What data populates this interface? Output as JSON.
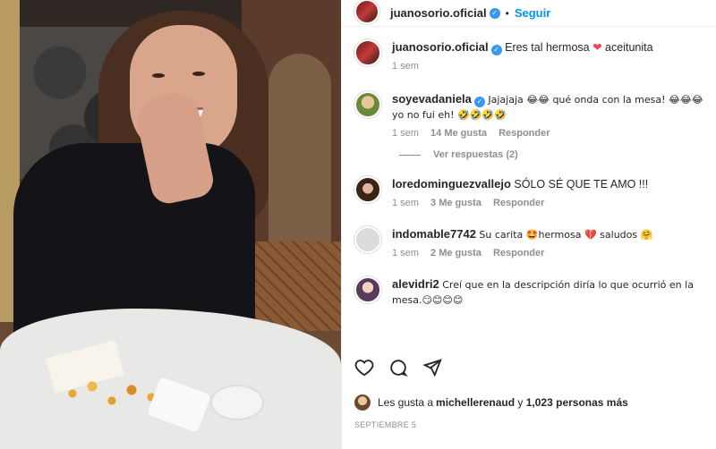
{
  "post": {
    "username": "juanosorio.oficial",
    "follow_label": "Seguir",
    "separator": "•"
  },
  "caption": {
    "username": "juanosorio.oficial",
    "text_before": "Eres tal hermosa ",
    "text_after": " aceitunita",
    "time": "1 sem"
  },
  "comments": [
    {
      "username": "soyevadaniela",
      "verified": true,
      "text": "Jajajaja 😂😂 qué onda con la mesa! 😂😂😂 yo no fui eh! 🤣🤣🤣🤣",
      "time": "1 sem",
      "likes": "14 Me gusta",
      "reply": "Responder",
      "view_replies": "Ver respuestas (2)"
    },
    {
      "username": "loredominguezvallejo",
      "text": "SÓLO SÉ QUE TE AMO !!!",
      "time": "1 sem",
      "likes": "3 Me gusta",
      "reply": "Responder"
    },
    {
      "username": "indomable7742",
      "text": "Su carita 🤩hermosa 💔 saludos 🤗",
      "time": "1 sem",
      "likes": "2 Me gusta",
      "reply": "Responder"
    },
    {
      "username": "alevidri2",
      "text": "Creí que en la descripción diría lo que ocurrió en la mesa.😏😊😊😊"
    }
  ],
  "likes": {
    "prefix": "Les gusta a ",
    "user": "michellerenaud",
    "middle": " y ",
    "count": "1,023 personas más"
  },
  "date": "SEPTIEMBRE 5"
}
